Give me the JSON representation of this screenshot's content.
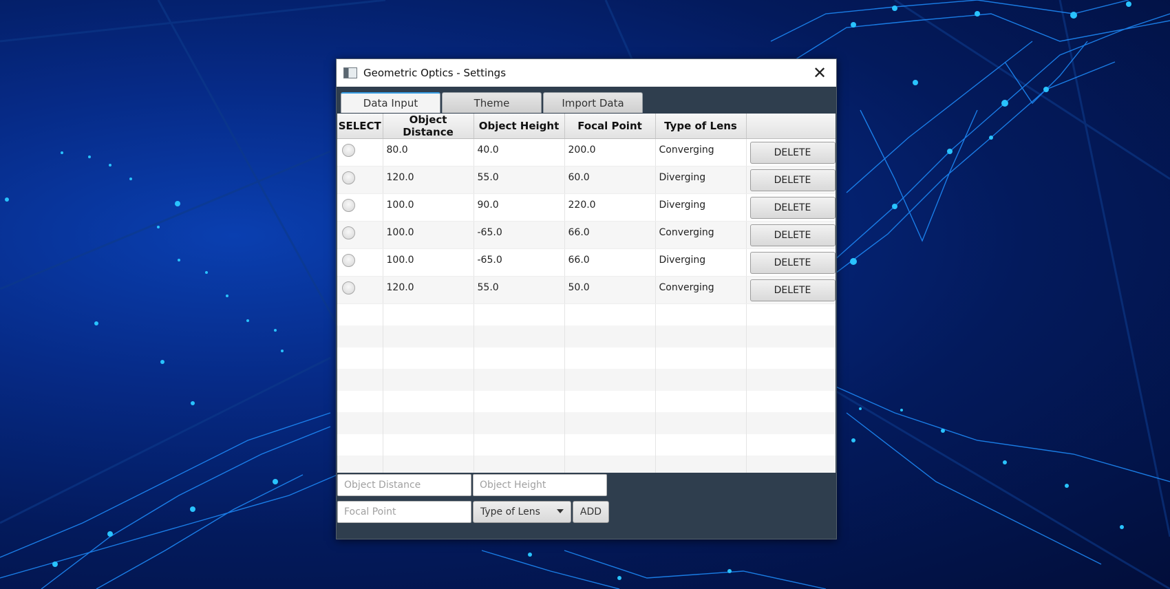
{
  "window": {
    "title": "Geometric Optics - Settings",
    "close_glyph": "✕"
  },
  "tabs": [
    {
      "label": "Data Input",
      "active": true
    },
    {
      "label": "Theme",
      "active": false
    },
    {
      "label": "Import Data",
      "active": false
    }
  ],
  "table": {
    "headers": [
      "SELECT",
      "Object Distance",
      "Object Height",
      "Focal Point",
      "Type of Lens",
      ""
    ],
    "delete_label": "DELETE",
    "rows": [
      {
        "distance": "80.0",
        "height": "40.0",
        "focal": "200.0",
        "lens": "Converging"
      },
      {
        "distance": "120.0",
        "height": "55.0",
        "focal": "60.0",
        "lens": "Diverging"
      },
      {
        "distance": "100.0",
        "height": "90.0",
        "focal": "220.0",
        "lens": "Diverging"
      },
      {
        "distance": "100.0",
        "height": "-65.0",
        "focal": "66.0",
        "lens": "Converging"
      },
      {
        "distance": "100.0",
        "height": "-65.0",
        "focal": "66.0",
        "lens": "Diverging"
      },
      {
        "distance": "120.0",
        "height": "55.0",
        "focal": "50.0",
        "lens": "Converging"
      }
    ]
  },
  "form": {
    "object_distance_placeholder": "Object Distance",
    "object_height_placeholder": "Object Height",
    "focal_point_placeholder": "Focal Point",
    "lens_select_label": "Type of Lens",
    "add_label": "ADD"
  },
  "colors": {
    "accent": "#3aa0e6",
    "window_body": "#2f3e4e",
    "background": "#031a5c"
  }
}
